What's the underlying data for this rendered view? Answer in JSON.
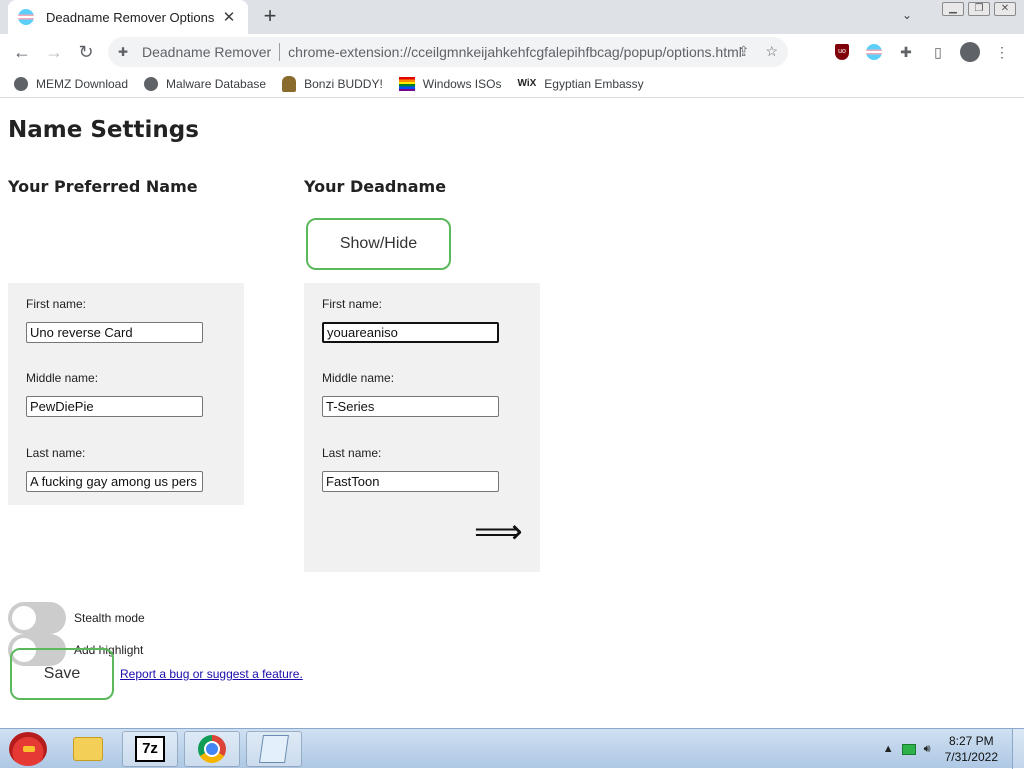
{
  "browser": {
    "tab_title": "Deadname Remover Options",
    "tab_close": "✕",
    "new_tab": "+",
    "site_name": "Deadname Remover",
    "url": "chrome-extension://cceilgmnkeijahkehfcgfalepihfbcag/popup/options.html",
    "ublock_label": "uo"
  },
  "bookmarks": [
    {
      "label": "MEMZ Download"
    },
    {
      "label": "Malware Database"
    },
    {
      "label": "Bonzi BUDDY!"
    },
    {
      "label": "Windows ISOs"
    },
    {
      "label": "Egyptian Embassy",
      "icon_text": "WiX"
    }
  ],
  "page": {
    "title": "Name Settings",
    "preferred": {
      "heading": "Your Preferred Name",
      "first_label": "First name:",
      "first_value": "Uno reverse Card",
      "middle_label": "Middle name:",
      "middle_value": "PewDiePie",
      "last_label": "Last name:",
      "last_value": "A fucking gay among us pers"
    },
    "deadname": {
      "heading": "Your Deadname",
      "show_hide": "Show/Hide",
      "first_label": "First name:",
      "first_value": "youareaniso",
      "middle_label": "Middle name:",
      "middle_value": "T-Series",
      "last_label": "Last name:",
      "last_value": "FastToon",
      "arrow": "⟹"
    },
    "stealth_label": "Stealth mode",
    "stealth_on": false,
    "highlight_label": "Add highlight",
    "highlight_on": false,
    "save_label": "Save",
    "report_link": "Report a bug or suggest a feature."
  },
  "taskbar": {
    "sevenzip_label": "7z",
    "time": "8:27 PM",
    "date": "7/31/2022"
  },
  "colors": {
    "accent_green": "#5cb85c",
    "panel_bg": "#f1f1f1",
    "link": "#1a0dab"
  }
}
